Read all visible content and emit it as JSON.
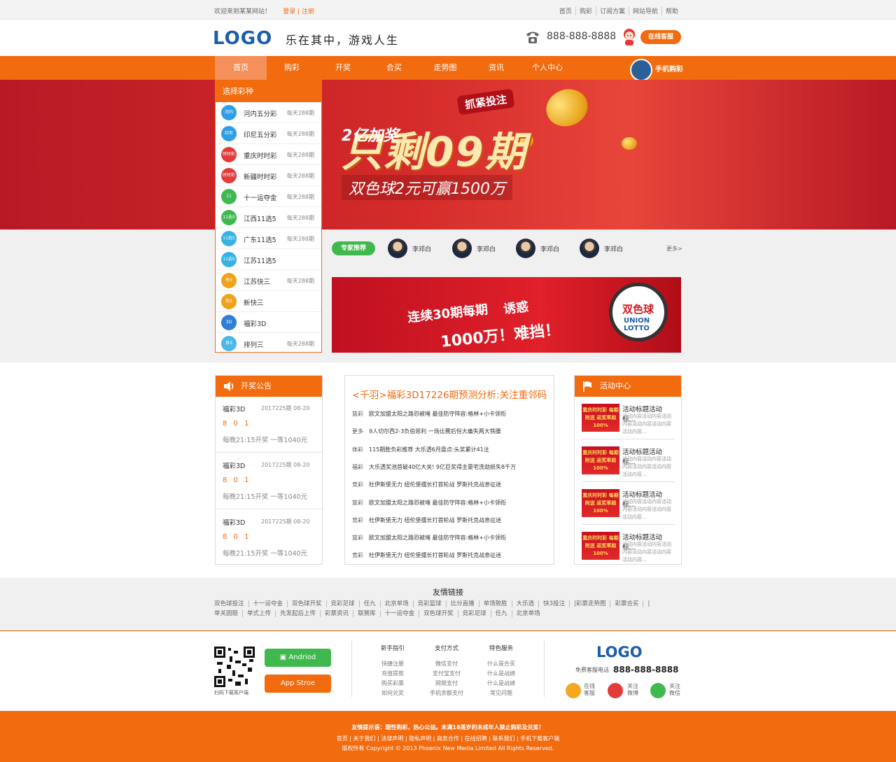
{
  "topbar": {
    "welcome": "欢迎来到某某网站！",
    "login": "登录",
    "sep": "|",
    "register": "注册",
    "links": [
      "首页",
      "购彩",
      "订阅方案",
      "网站导航",
      "帮助"
    ]
  },
  "header": {
    "logo": "LOGO",
    "slogan": "乐在其中，游戏人生",
    "phone": "888-888-8888",
    "cs_button": "在线客服"
  },
  "nav": {
    "items": [
      "首页",
      "购彩",
      "开奖",
      "合买",
      "走势图",
      "资讯",
      "个人中心"
    ],
    "active": 0,
    "mobile": "手机购彩"
  },
  "banner": {
    "badge": "抓紧投注",
    "line1": "2亿加奖",
    "line2": "只剩09期",
    "line3": "双色球2元可赢1500万"
  },
  "lottery": {
    "title": "选择彩种",
    "items": [
      {
        "name": "河内五分彩",
        "per": "每天288期",
        "icon": "河内",
        "color": "#2e9ee6"
      },
      {
        "name": "印尼五分彩",
        "per": "每天288期",
        "icon": "印尼",
        "color": "#2e9ee6"
      },
      {
        "name": "重庆时时彩",
        "per": "每天288期",
        "icon": "时时彩",
        "color": "#e23b3b"
      },
      {
        "name": "新疆时时彩",
        "per": "每天288期",
        "icon": "时时彩",
        "color": "#e23b3b"
      },
      {
        "name": "十一运夺金",
        "per": "每天288期",
        "icon": "11",
        "color": "#3fb94e"
      },
      {
        "name": "江西11选5",
        "per": "每天288期",
        "icon": "11选5",
        "color": "#3fb94e"
      },
      {
        "name": "广东11选5",
        "per": "每天288期",
        "icon": "11选5",
        "color": "#36b2e0"
      },
      {
        "name": "江苏11选5",
        "per": "",
        "icon": "11选5",
        "color": "#36b2e0"
      },
      {
        "name": "江苏快三",
        "per": "每天288期",
        "icon": "快3",
        "color": "#f0a21a"
      },
      {
        "name": "新快三",
        "per": "",
        "icon": "快3",
        "color": "#f0a21a"
      },
      {
        "name": "福彩3D",
        "per": "",
        "icon": "3D",
        "color": "#2e7fd6"
      },
      {
        "name": "排列三",
        "per": "每天288期",
        "icon": "排3",
        "color": "#4cb8e8"
      }
    ]
  },
  "experts": {
    "tag": "专家推荐",
    "names": [
      "李邓白",
      "李邓白",
      "李邓白",
      "李邓白"
    ],
    "more": "更多>"
  },
  "banner2": {
    "t1": "连续30期每期",
    "t2": "诱惑",
    "t3": "1000万！难挡！",
    "logo1": "双色球",
    "logo2": "UNION LOTTO"
  },
  "announce": {
    "title": "开奖公告",
    "items": [
      {
        "name": "福彩3D",
        "date": "2017225期  08-20",
        "num": "8 0 1",
        "time": "每晚21:15开奖  一等1040元"
      },
      {
        "name": "福彩3D",
        "date": "2017225期  08-20",
        "num": "8 0 1",
        "time": "每晚21:15开奖  一等1040元"
      },
      {
        "name": "福彩3D",
        "date": "2017225期  08-20",
        "num": "8 0 1",
        "time": "每晚21:15开奖  一等1040元"
      }
    ]
  },
  "news": {
    "title": "<千羽>福彩3D17226期预测分析:关注重邻码",
    "items": [
      {
        "cat": "篮彩",
        "text": "欧文加盟太阳之路恐被堵 最佳防守阵容:格林+小卡领衔"
      },
      {
        "cat": "更多",
        "text": "9人切尔西2-3负伯恩利 一场比赛后恒大痛失两大铁腰"
      },
      {
        "cat": "体彩",
        "text": "115期胜负彩推荐 大乐透6月盘点:头奖累计41注"
      },
      {
        "cat": "福彩",
        "text": "大乐透奖池首破40亿大关! 9亿巨奖得主豪宅洗劫损失8千万"
      },
      {
        "cat": "竞彩",
        "text": "杜伊斯堡无力 纽伦堡擂长打首轮战 罗斯托克战息征迷"
      },
      {
        "cat": "篮彩",
        "text": "欧文加盟太阳之路恐被堵 最佳防守阵容:格林+小卡领衔"
      },
      {
        "cat": "竞彩",
        "text": "杜伊斯堡无力 纽伦堡擂长打首轮战 罗斯托克战息征迷"
      },
      {
        "cat": "篮彩",
        "text": "欧文加盟太阳之路恐被堵 最佳防守阵容:格林+小卡领衔"
      },
      {
        "cat": "竞彩",
        "text": "杜伊斯堡无力 纽伦堡擂长打首轮战 罗斯托克战息征迷"
      }
    ]
  },
  "activity": {
    "title": "活动中心",
    "img_text": "重庆时时彩 每期附送 返奖率超100%",
    "items": [
      {
        "title": "活动标题活动标...",
        "desc": "活动内容活动内容活动内容活动内容活动内容活动内容..."
      },
      {
        "title": "活动标题活动标...",
        "desc": "活动内容活动内容活动内容活动内容活动内容活动内容..."
      },
      {
        "title": "活动标题活动标...",
        "desc": "活动内容活动内容活动内容活动内容活动内容活动内容..."
      },
      {
        "title": "活动标题活动标...",
        "desc": "活动内容活动内容活动内容活动内容活动内容活动内容..."
      }
    ]
  },
  "links": {
    "title": "友情链接",
    "row1": [
      "双色球投注",
      "十一运夺金",
      "双色球开奖",
      "竞彩足球",
      "任九",
      "北京单场",
      "竞彩篮球",
      "比分直播",
      "单场致胜",
      "大乐透",
      "快3投注",
      "|彩票走势图",
      "彩票合买",
      "|"
    ],
    "row2": [
      "单关固赔",
      "单式上传",
      "先发起后上传",
      "彩票资讯",
      "联赛库",
      "十一运夺金",
      "双色球开奖",
      "竞彩足球",
      "任九",
      "北京单场"
    ]
  },
  "footer": {
    "qr_caption": "扫码下载客户端",
    "android": "Andriod",
    "appstore": "App Stroe",
    "cols": [
      {
        "h": "新手指引",
        "items": [
          "快捷注册",
          "充值提款",
          "购买彩票",
          "如何兑奖"
        ]
      },
      {
        "h": "支付方式",
        "items": [
          "微信支付",
          "支付宝支付",
          "网银支付",
          "手机余额支付"
        ]
      },
      {
        "h": "特色服务",
        "items": [
          "什么是合买",
          "什么是战绩",
          "什么是战绩",
          "常见问题"
        ]
      }
    ],
    "logo": "LOGO",
    "cs_label": "免费客服电话",
    "phone": "888-888-8888",
    "social": [
      {
        "t1": "在线",
        "t2": "客服"
      },
      {
        "t1": "关注",
        "t2": "微博"
      },
      {
        "t1": "关注",
        "t2": "微信"
      }
    ]
  },
  "bottom": {
    "tip": "友情提示语：理性购彩，热心公益。未满18周岁的未成年人禁止购彩及兑奖！",
    "links": "首页 | 关于我们 | 法律声明 | 隐私声明 | 商务合作 | 在线招聘 | 联系我们 | 手机下载客户端",
    "copy": "版权所有 Copyright © 2013 Phoenix New Media Limited All Rights Reserved."
  }
}
